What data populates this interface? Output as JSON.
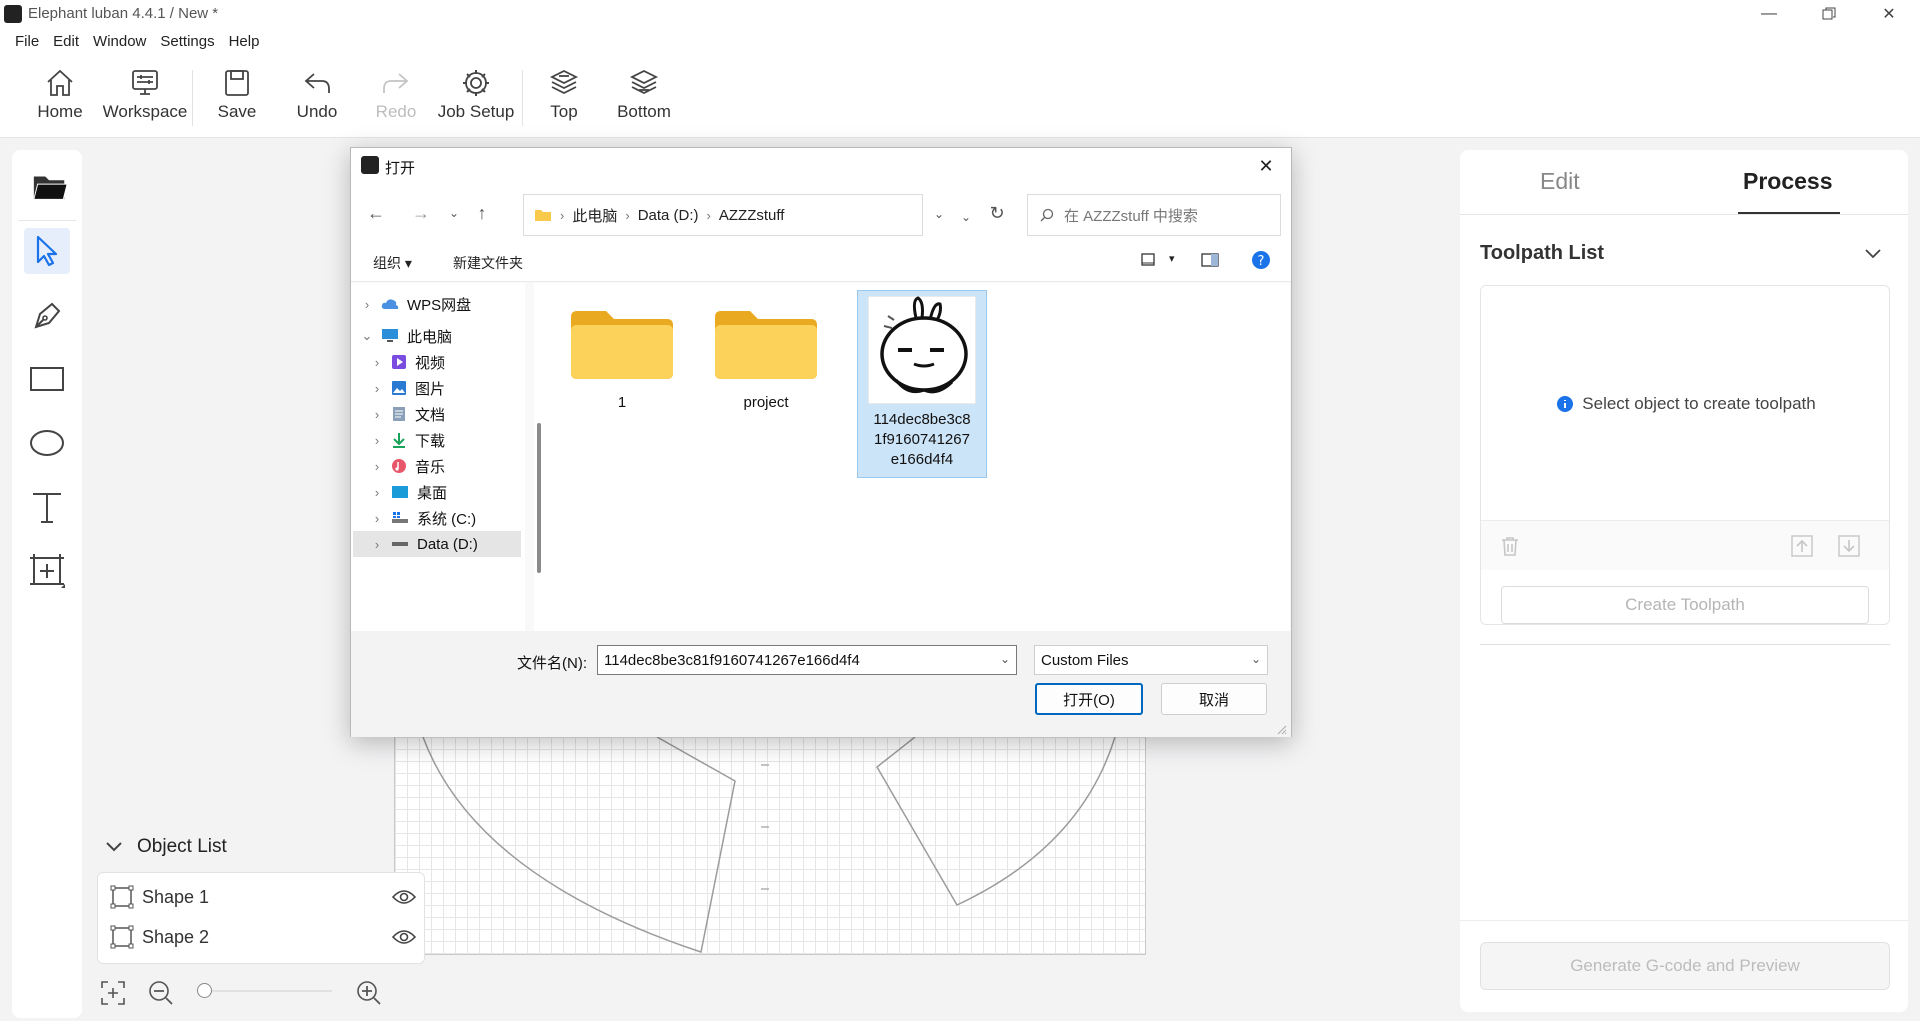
{
  "window": {
    "title": "Elephant luban 4.4.1 / New *"
  },
  "menu": [
    "File",
    "Edit",
    "Window",
    "Settings",
    "Help"
  ],
  "toolbar": {
    "home": "Home",
    "workspace": "Workspace",
    "save": "Save",
    "undo": "Undo",
    "redo": "Redo",
    "job_setup": "Job Setup",
    "top": "Top",
    "bottom": "Bottom"
  },
  "object_list": {
    "title": "Object List",
    "items": [
      {
        "name": "Shape 1"
      },
      {
        "name": "Shape 2"
      }
    ]
  },
  "right_panel": {
    "tab_edit": "Edit",
    "tab_process": "Process",
    "toolpath_title": "Toolpath List",
    "empty_hint": "Select object to create toolpath",
    "create_toolpath": "Create Toolpath",
    "generate": "Generate G-code and Preview"
  },
  "dialog": {
    "title": "打开",
    "breadcrumb": [
      "此电脑",
      "Data (D:)",
      "AZZZstuff"
    ],
    "search_placeholder": "在 AZZZstuff 中搜索",
    "organize": "组织",
    "new_folder": "新建文件夹",
    "nav": [
      {
        "label": "WPS网盘",
        "level": 0
      },
      {
        "label": "此电脑",
        "level": 0
      },
      {
        "label": "视频",
        "level": 1
      },
      {
        "label": "图片",
        "level": 1
      },
      {
        "label": "文档",
        "level": 1
      },
      {
        "label": "下载",
        "level": 1
      },
      {
        "label": "音乐",
        "level": 1
      },
      {
        "label": "桌面",
        "level": 1
      },
      {
        "label": "系统 (C:)",
        "level": 1
      },
      {
        "label": "Data (D:)",
        "level": 1
      }
    ],
    "files": [
      {
        "name": "1",
        "type": "folder"
      },
      {
        "name": "project",
        "type": "folder"
      },
      {
        "name": "114dec8be3c81f9160741267e166d4f4",
        "type": "image"
      }
    ],
    "filename_label": "文件名(N):",
    "filename_value": "114dec8be3c81f9160741267e166d4f4",
    "filetype": "Custom Files",
    "open": "打开(O)",
    "cancel": "取消"
  },
  "colors": {
    "accent": "#0067c0",
    "folder": "#f8c94a",
    "selection": "#cce4f7",
    "tool_selected": "#1a73e8"
  }
}
